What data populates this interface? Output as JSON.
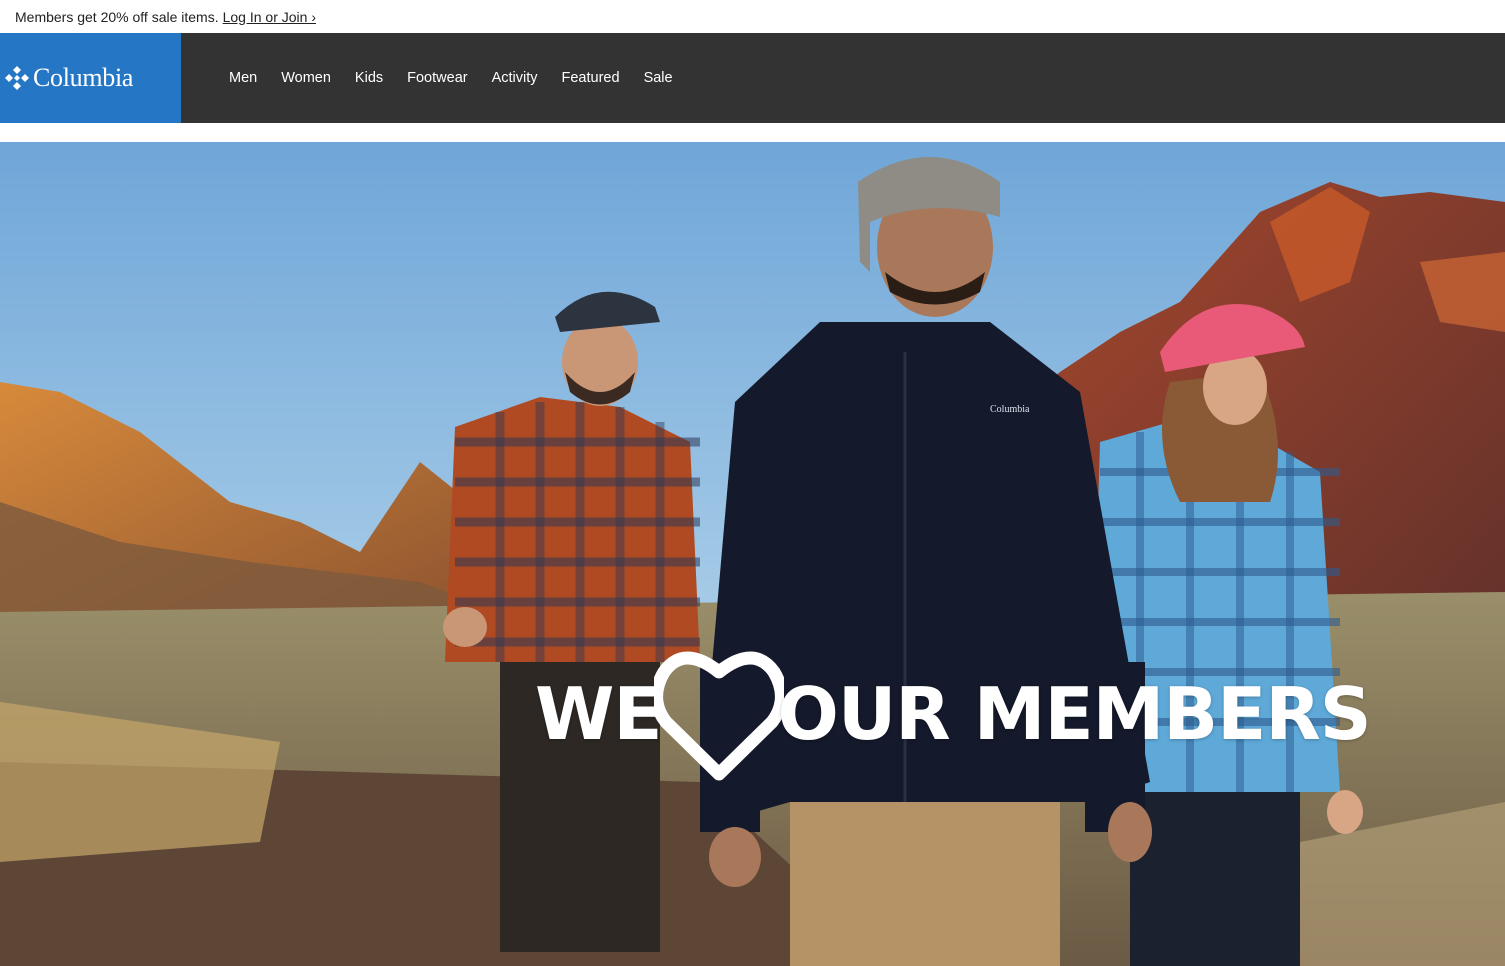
{
  "promo": {
    "text": "Members get 20% off sale items.",
    "link": "Log In or Join ›"
  },
  "brand": {
    "name": "Columbia",
    "color": "#2577c5"
  },
  "nav": {
    "items": [
      "Men",
      "Women",
      "Kids",
      "Footwear",
      "Activity",
      "Featured",
      "Sale"
    ]
  },
  "hero": {
    "headline_left": "WE",
    "headline_icon": "heart-icon",
    "headline_right": "OUR MEMBERS",
    "jacket_logo": "Columbia"
  }
}
